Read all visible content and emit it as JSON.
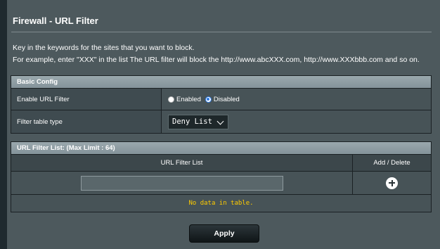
{
  "page": {
    "title": "Firewall - URL Filter",
    "description_line1": "Key in the keywords for the sites that you want to block.",
    "description_line2": "For example, enter \"XXX\" in the list The URL filter will block the http://www.abcXXX.com, http://www.XXXbbb.com and so on."
  },
  "basic_config": {
    "header": "Basic Config",
    "enable_label": "Enable URL Filter",
    "enable_options": [
      "Enabled",
      "Disabled"
    ],
    "enable_selected": "Disabled",
    "filter_type_label": "Filter table type",
    "filter_type_value": "Deny List"
  },
  "filter_list": {
    "header": "URL Filter List: (Max Limit : 64)",
    "col_list": "URL Filter List",
    "col_action": "Add / Delete",
    "empty_text": "No data in table."
  },
  "actions": {
    "apply_label": "Apply"
  },
  "colors": {
    "background": "#4d595d",
    "header_bar": "#92a0a5",
    "empty_text": "#ffcc00",
    "radio_selected": "#2d7be5"
  }
}
